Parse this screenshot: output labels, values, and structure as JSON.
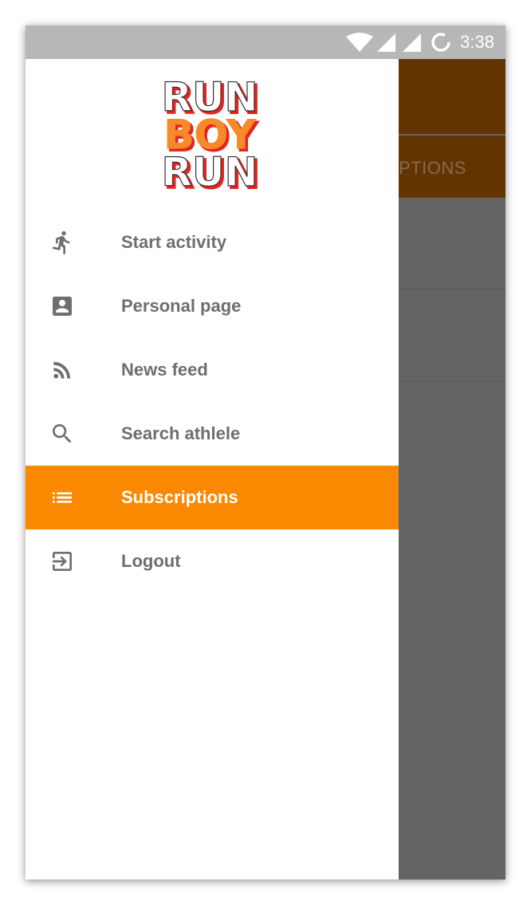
{
  "status_bar": {
    "time": "3:38",
    "icons": [
      "wifi-icon",
      "signal-icon",
      "signal-icon",
      "sync-icon"
    ]
  },
  "background_app": {
    "tab_label_partial": "PTIONS"
  },
  "drawer": {
    "logo": {
      "lines": [
        "RUN",
        "BOY",
        "RUN"
      ]
    },
    "items": [
      {
        "label": "Start activity",
        "icon": "run-icon"
      },
      {
        "label": "Personal page",
        "icon": "account-box-icon"
      },
      {
        "label": "News feed",
        "icon": "rss-feed-icon"
      },
      {
        "label": "Search athlele",
        "icon": "search-icon"
      },
      {
        "label": "Subscriptions",
        "icon": "list-icon",
        "selected": true
      },
      {
        "label": "Logout",
        "icon": "exit-to-app-icon"
      }
    ]
  },
  "colors": {
    "accent": "#fb8801",
    "toolbar_dimmed": "#623402",
    "scrim": "#646464",
    "status_bar": "#b7b7b7",
    "logo_red": "#e8231e",
    "logo_orange": "#f48a2a"
  }
}
